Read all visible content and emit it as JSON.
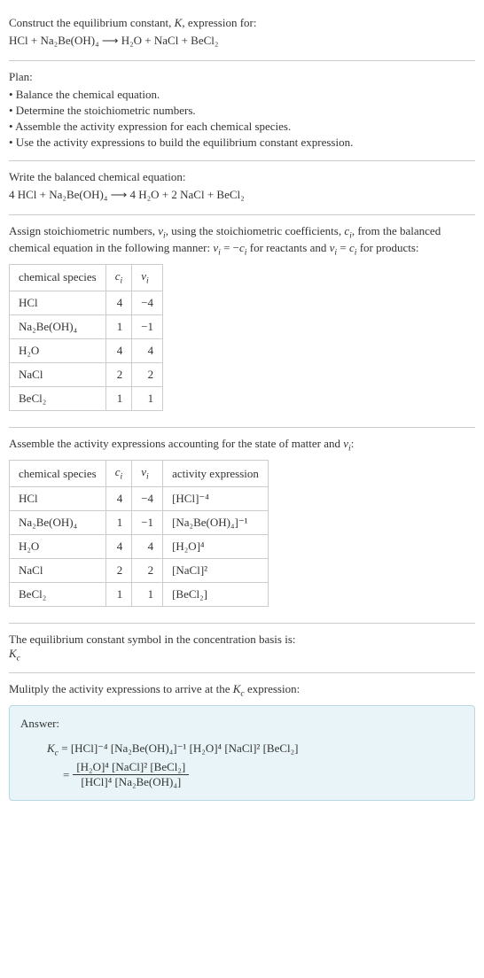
{
  "intro": {
    "line1": "Construct the equilibrium constant, K, expression for:",
    "equation": "HCl + Na₂Be(OH)₄  ⟶  H₂O + NaCl + BeCl₂"
  },
  "plan": {
    "header": "Plan:",
    "items": [
      "• Balance the chemical equation.",
      "• Determine the stoichiometric numbers.",
      "• Assemble the activity expression for each chemical species.",
      "• Use the activity expressions to build the equilibrium constant expression."
    ]
  },
  "balanced": {
    "header": "Write the balanced chemical equation:",
    "equation": "4 HCl + Na₂Be(OH)₄  ⟶  4 H₂O + 2 NaCl + BeCl₂"
  },
  "stoich": {
    "intro": "Assign stoichiometric numbers, νᵢ, using the stoichiometric coefficients, cᵢ, from the balanced chemical equation in the following manner: νᵢ = −cᵢ for reactants and νᵢ = cᵢ for products:",
    "headers": [
      "chemical species",
      "cᵢ",
      "νᵢ"
    ],
    "rows": [
      {
        "species": "HCl",
        "c": "4",
        "v": "−4"
      },
      {
        "species": "Na₂Be(OH)₄",
        "c": "1",
        "v": "−1"
      },
      {
        "species": "H₂O",
        "c": "4",
        "v": "4"
      },
      {
        "species": "NaCl",
        "c": "2",
        "v": "2"
      },
      {
        "species": "BeCl₂",
        "c": "1",
        "v": "1"
      }
    ]
  },
  "activity": {
    "intro": "Assemble the activity expressions accounting for the state of matter and νᵢ:",
    "headers": [
      "chemical species",
      "cᵢ",
      "νᵢ",
      "activity expression"
    ],
    "rows": [
      {
        "species": "HCl",
        "c": "4",
        "v": "−4",
        "expr": "[HCl]⁻⁴"
      },
      {
        "species": "Na₂Be(OH)₄",
        "c": "1",
        "v": "−1",
        "expr": "[Na₂Be(OH)₄]⁻¹"
      },
      {
        "species": "H₂O",
        "c": "4",
        "v": "4",
        "expr": "[H₂O]⁴"
      },
      {
        "species": "NaCl",
        "c": "2",
        "v": "2",
        "expr": "[NaCl]²"
      },
      {
        "species": "BeCl₂",
        "c": "1",
        "v": "1",
        "expr": "[BeCl₂]"
      }
    ]
  },
  "symbol": {
    "line1": "The equilibrium constant symbol in the concentration basis is:",
    "line2": "K꜀"
  },
  "multiply": {
    "text": "Mulitply the activity expressions to arrive at the K꜀ expression:"
  },
  "answer": {
    "label": "Answer:",
    "kc_label": "K꜀ = ",
    "line1": "[HCl]⁻⁴ [Na₂Be(OH)₄]⁻¹ [H₂O]⁴ [NaCl]² [BeCl₂]",
    "eq_label": "= ",
    "frac_num": "[H₂O]⁴ [NaCl]² [BeCl₂]",
    "frac_den": "[HCl]⁴ [Na₂Be(OH)₄]"
  }
}
